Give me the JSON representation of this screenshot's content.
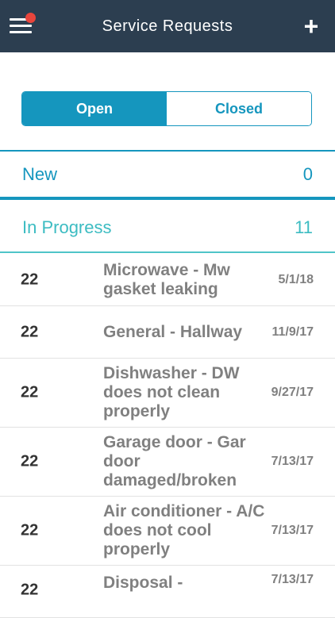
{
  "header": {
    "title": "Service Requests",
    "add_label": "+"
  },
  "tabs": [
    {
      "label": "Open",
      "selected": true
    },
    {
      "label": "Closed",
      "selected": false
    }
  ],
  "sections": {
    "new": {
      "label": "New",
      "count": "0"
    },
    "in_progress": {
      "label": "In Progress",
      "count": "11"
    }
  },
  "requests": [
    {
      "number": "22",
      "description": "Microwave - Mw gasket leaking",
      "date": "5/1/18"
    },
    {
      "number": "22",
      "description": "General - Hallway",
      "date": "11/9/17"
    },
    {
      "number": "22",
      "description": "Dishwasher - DW does not clean properly",
      "date": "9/27/17"
    },
    {
      "number": "22",
      "description": "Garage door - Gar door damaged/broken",
      "date": "7/13/17"
    },
    {
      "number": "22",
      "description": "Air conditioner - A/C does not cool properly",
      "date": "7/13/17"
    },
    {
      "number": "22",
      "description": "Disposal -",
      "date": "7/13/17"
    }
  ],
  "colors": {
    "navbar": "#2c3e50",
    "accent": "#1596be",
    "teal": "#3cbcc2",
    "notification": "#e8453c"
  }
}
